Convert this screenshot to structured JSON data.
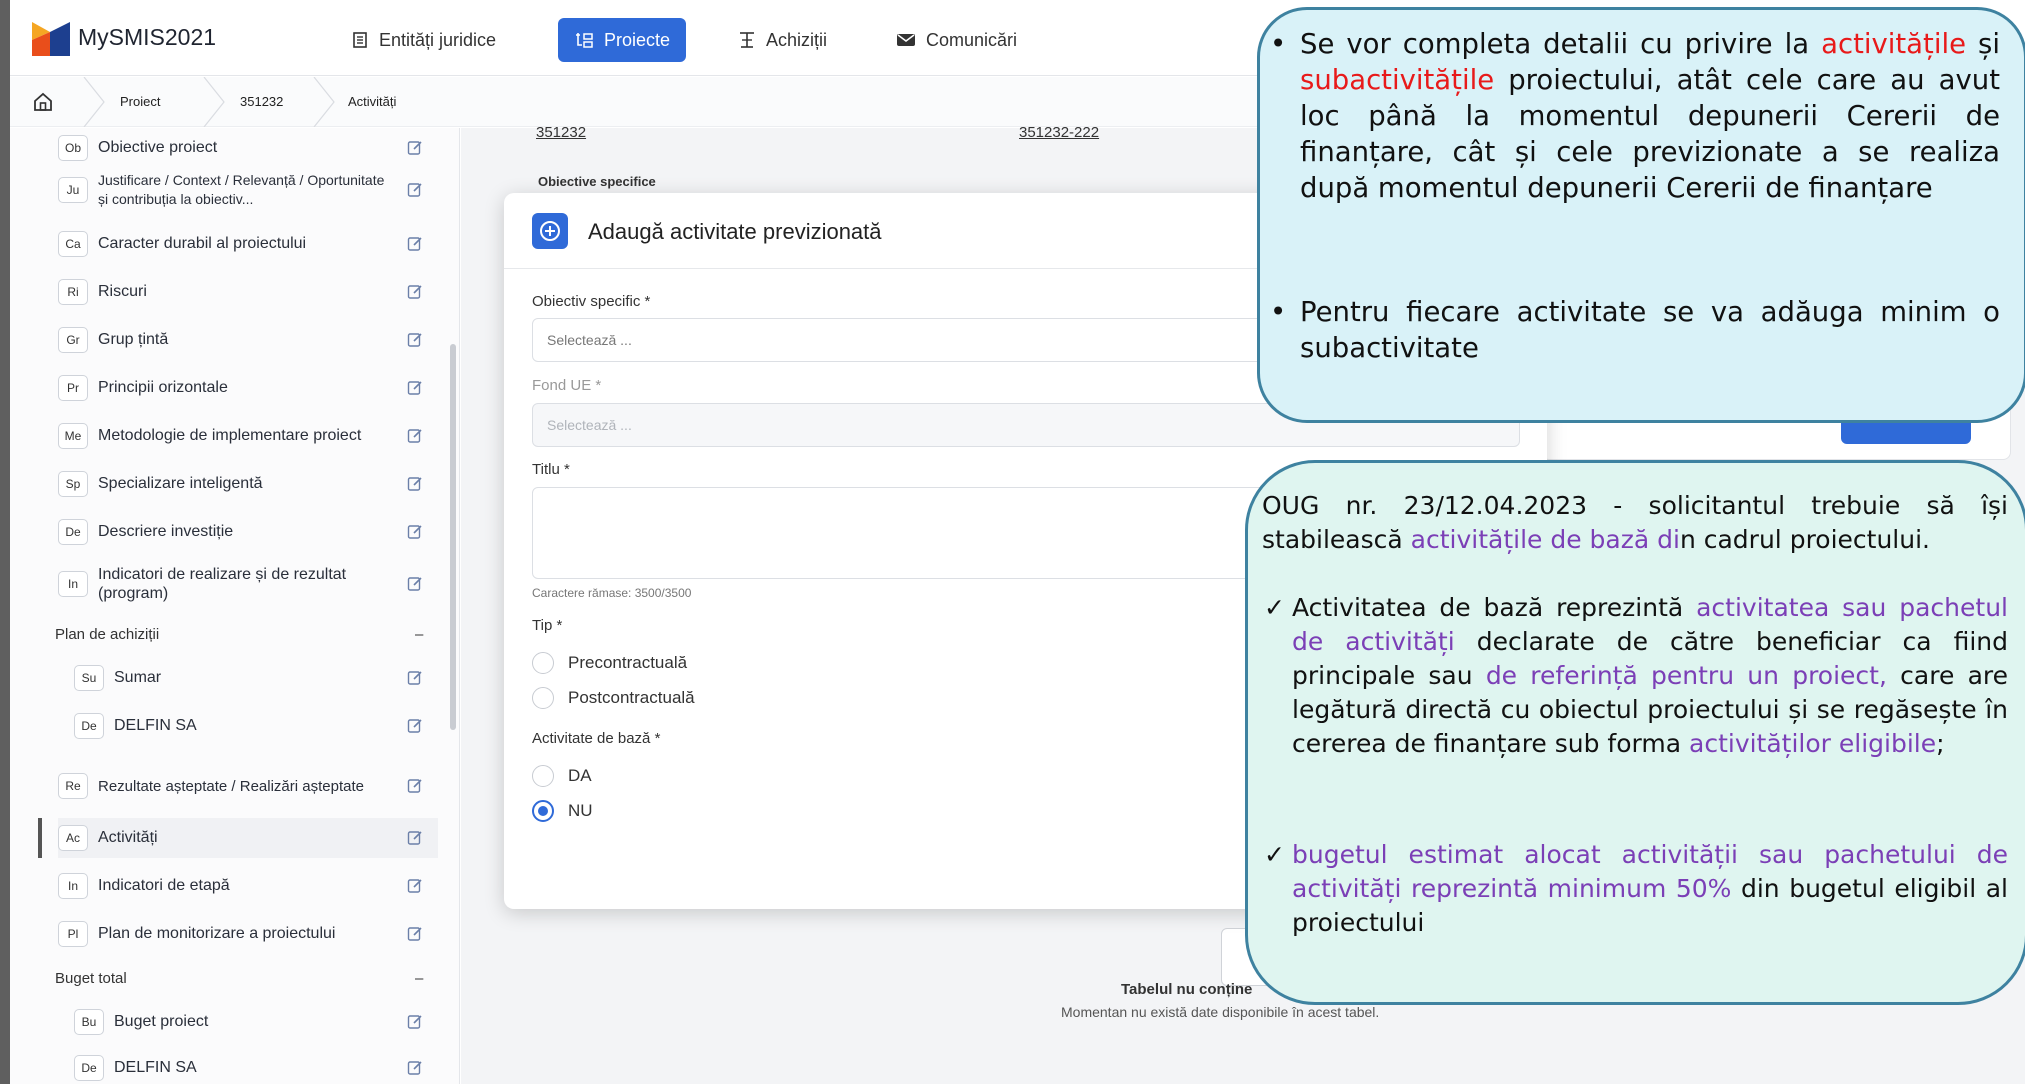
{
  "header": {
    "app_title": "MySMIS2021",
    "nav": {
      "entitati": "Entități juridice",
      "proiecte": "Proiecte",
      "achizitii": "Achiziții",
      "comunicari": "Comunicări"
    }
  },
  "breadcrumb": {
    "items": [
      "Proiect",
      "351232",
      "Activități"
    ]
  },
  "sidebar": {
    "items": [
      {
        "abbr": "Ob",
        "label": "Obiective proiect"
      },
      {
        "abbr": "Ju",
        "label": "Justificare / Context / Relevanță / Oportunitate și contribuția la obiectiv..."
      },
      {
        "abbr": "Ca",
        "label": "Caracter durabil al proiectului"
      },
      {
        "abbr": "Ri",
        "label": "Riscuri"
      },
      {
        "abbr": "Gr",
        "label": "Grup țintă"
      },
      {
        "abbr": "Pr",
        "label": "Principii orizontale"
      },
      {
        "abbr": "Me",
        "label": "Metodologie de implementare proiect"
      },
      {
        "abbr": "Sp",
        "label": "Specializare inteligentă"
      },
      {
        "abbr": "De",
        "label": "Descriere investiție"
      },
      {
        "abbr": "In",
        "label": "Indicatori de realizare și de rezultat (program)"
      }
    ],
    "section_achizitii": "Plan de achiziții",
    "achizitii_items": [
      {
        "abbr": "Su",
        "label": "Sumar"
      },
      {
        "abbr": "De",
        "label": "DELFIN SA"
      }
    ],
    "items2": [
      {
        "abbr": "Re",
        "label": "Rezultate așteptate / Realizări așteptate"
      },
      {
        "abbr": "Ac",
        "label": "Activități"
      },
      {
        "abbr": "In",
        "label": "Indicatori de etapă"
      },
      {
        "abbr": "Pl",
        "label": "Plan de monitorizare a proiectului"
      }
    ],
    "section_buget": "Buget total",
    "buget_items": [
      {
        "abbr": "Bu",
        "label": "Buget proiect"
      },
      {
        "abbr": "De",
        "label": "DELFIN SA"
      }
    ],
    "collapse_symbol": "–"
  },
  "main": {
    "top_left_value": "351232",
    "top_right_value": "351232-222",
    "obiective_label": "Obiective specifice",
    "empty_title": "Tabelul nu conține",
    "empty_text": "Momentan nu există date disponibile în acest tabel."
  },
  "modal": {
    "title": "Adaugă activitate previzionată",
    "obiectiv_label": "Obiectiv specific *",
    "obiectiv_placeholder": "Selectează ...",
    "fond_label": "Fond UE *",
    "fond_placeholder": "Selectează ...",
    "titlu_label": "Titlu *",
    "chars_left": "Caractere rămase: 3500/3500",
    "tip_label": "Tip *",
    "tip_options": [
      "Precontractuală",
      "Postcontractuală"
    ],
    "baza_label": "Activitate de bază *",
    "baza_options": [
      "DA",
      "NU"
    ],
    "baza_selected": "NU"
  },
  "callout1": {
    "b1_p1": "Se vor completa detalii cu privire la ",
    "b1_red1": "activitățile",
    "b1_p2": " și ",
    "b1_red2": "subactivitățile",
    "b1_p3": " proiectului, atât cele care au avut loc până la momentul depunerii Cererii de finanțare, cât și cele previzionate a se realiza după momentul depunerii Cererii de finanțare",
    "b2": "Pentru fiecare activitate se va adăuga minim o subactivitate",
    "bullet": "•"
  },
  "callout2": {
    "lead_p1": "OUG nr. 23/12.04.2023 -  solicitantul trebuie să își stabilească ",
    "lead_pur": "activitățile   de bază di",
    "lead_p2": "n cadrul proiectului.",
    "c1_p1": "Activitatea de bază  reprezintă ",
    "c1_pur1": "activitatea sau pachetul de activități",
    "c1_p2": " declarate de către beneficiar ca fiind principale sau ",
    "c1_pur2": "de referință pentru un proiect,",
    "c1_p3": " care are legătură directă cu obiectul proiectului  și se regăsește în cererea de finanțare sub forma ",
    "c1_pur3": "activităților eligibile",
    "c1_p4": ";",
    "c2_pur": "bugetul estimat alocat activității sau pachetului de activități reprezintă minimum 50%",
    "c2_p": " din bugetul eligibil al proiectului",
    "check": "✓"
  },
  "colors": {
    "accent": "#2f6ad8",
    "callout_border": "#3e82a0",
    "callout1_fill": "#d9f2f8",
    "callout2_fill": "#dff5f0",
    "highlight_red": "#e81a1a",
    "highlight_purple": "#7b3fb6"
  },
  "icons": [
    "logo-icon",
    "building-icon",
    "projects-icon",
    "tender-icon",
    "mail-icon",
    "home-icon",
    "edit-icon",
    "plus-circle-icon"
  ]
}
